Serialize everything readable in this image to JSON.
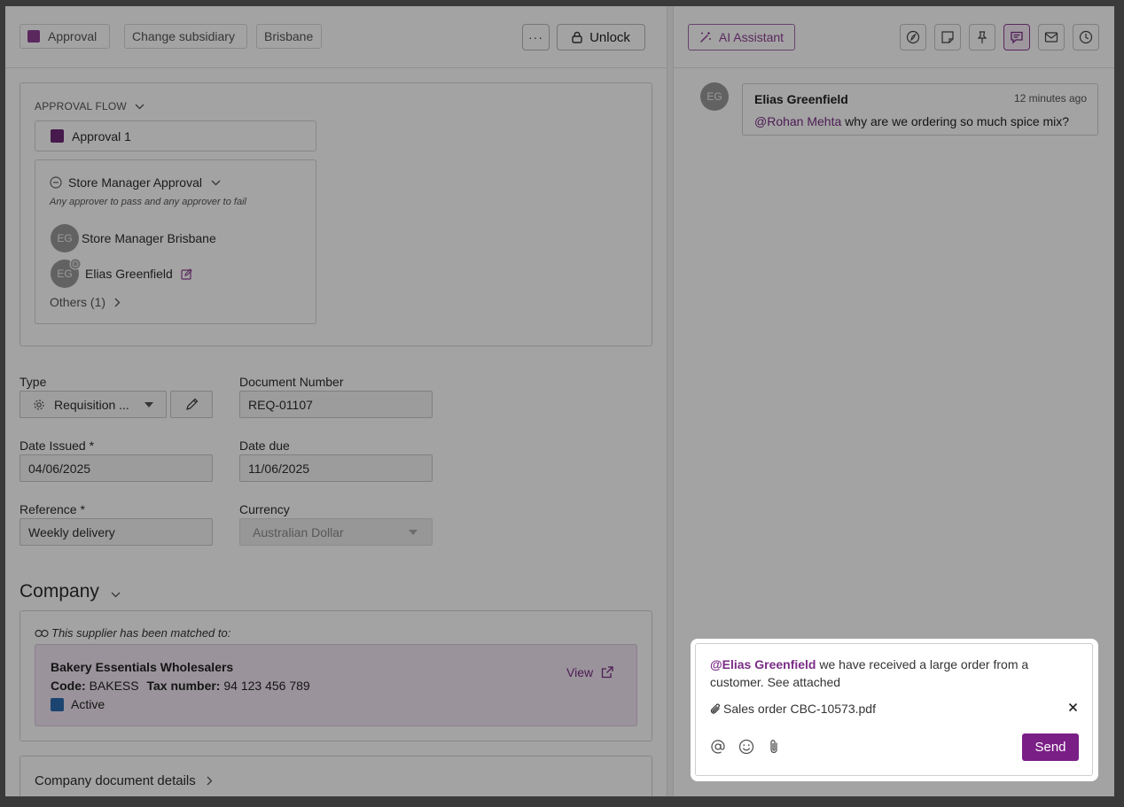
{
  "header": {
    "status_chip": "Approval",
    "status_color": "#8e3f95",
    "change_subsidiary": "Change subsidiary",
    "location_chip": "Brisbane",
    "more_label": "···",
    "unlock_label": "Unlock"
  },
  "approval": {
    "section_title": "APPROVAL FLOW",
    "selected_flow": "Approval 1",
    "flow_color": "#6e2a78",
    "stage_title": "Store Manager Approval",
    "stage_rule": "Any approver to pass and any approver to fail",
    "approvers": [
      {
        "initials": "EG",
        "name": "Store Manager Brisbane"
      },
      {
        "initials": "EG",
        "name": "Elias Greenfield"
      }
    ],
    "others_label": "Others (1)"
  },
  "form": {
    "type_label": "Type",
    "type_value": "Requisition ...",
    "docnum_label": "Document Number",
    "docnum_value": "REQ-01107",
    "date_issued_label": "Date Issued *",
    "date_issued_value": "04/06/2025",
    "date_due_label": "Date due",
    "date_due_value": "11/06/2025",
    "reference_label": "Reference *",
    "reference_value": "Weekly delivery",
    "currency_label": "Currency",
    "currency_value": "Australian Dollar"
  },
  "company": {
    "heading": "Company",
    "matched_note": "This supplier has been matched to:",
    "supplier_name": "Bakery Essentials Wholesalers",
    "code_label": "Code:",
    "code_value": "BAKESS",
    "tax_label": "Tax number:",
    "tax_value": "94 123 456 789",
    "status": "Active",
    "status_color": "#2b6cb0",
    "view_label": "View",
    "details_heading": "Company document details"
  },
  "right_panel": {
    "ai_button": "AI Assistant",
    "toolbar_icons": [
      "compass-icon",
      "sticky-note-icon",
      "pin-icon",
      "comment-icon",
      "mail-icon",
      "clock-icon"
    ],
    "comment": {
      "initials": "EG",
      "author": "Elias Greenfield",
      "time": "12 minutes ago",
      "mention": "@Rohan Mehta",
      "text": " why are we ordering so much spice mix?"
    }
  },
  "composer": {
    "mention": "@Elias Greenfield",
    "text": " we have received a large order from a customer. See attached",
    "attachment": "Sales order CBC-10573.pdf",
    "send_label": "Send",
    "accent": "#7a1f86"
  }
}
